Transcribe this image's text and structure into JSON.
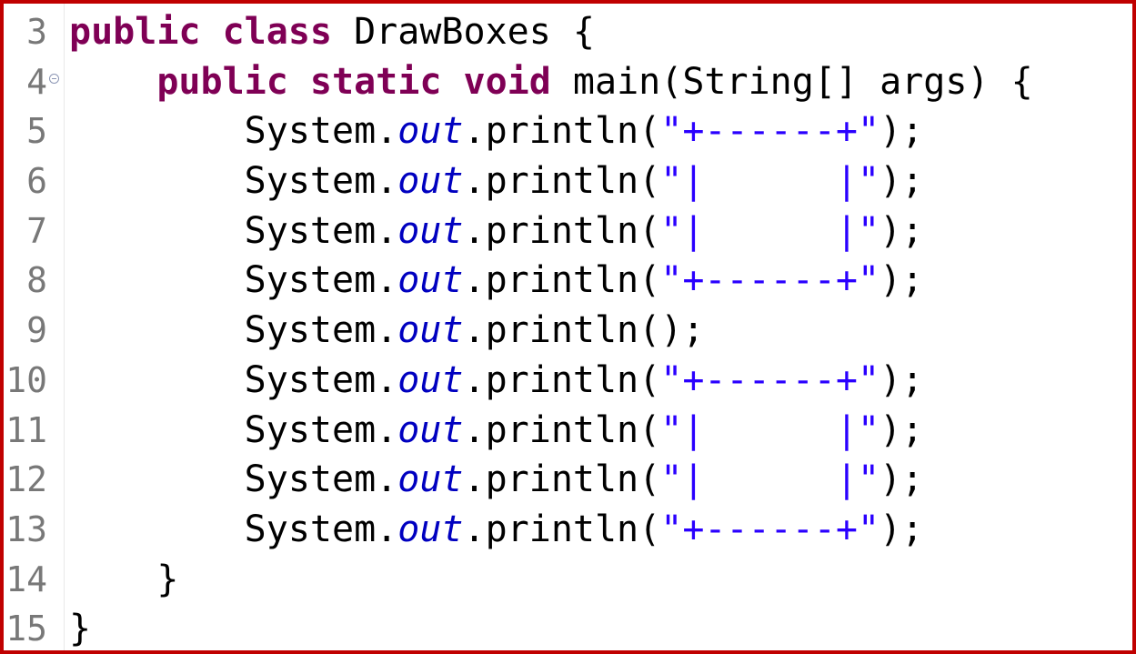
{
  "editor": {
    "lines": [
      {
        "no": "3",
        "indent": "",
        "tokens": [
          [
            "kw",
            "public"
          ],
          [
            "p",
            " "
          ],
          [
            "kw",
            "class"
          ],
          [
            "p",
            " DrawBoxes {"
          ]
        ]
      },
      {
        "no": "4",
        "indent": "    ",
        "fold": true,
        "tokens": [
          [
            "kw",
            "public"
          ],
          [
            "p",
            " "
          ],
          [
            "kw",
            "static"
          ],
          [
            "p",
            " "
          ],
          [
            "kw",
            "void"
          ],
          [
            "p",
            " main(String[] args) {"
          ]
        ]
      },
      {
        "no": "5",
        "indent": "        ",
        "tokens": [
          [
            "p",
            "System."
          ],
          [
            "field",
            "out"
          ],
          [
            "p",
            ".println("
          ],
          [
            "str",
            "\"+------+\""
          ],
          [
            "p",
            ");"
          ]
        ]
      },
      {
        "no": "6",
        "indent": "        ",
        "tokens": [
          [
            "p",
            "System."
          ],
          [
            "field",
            "out"
          ],
          [
            "p",
            ".println("
          ],
          [
            "str",
            "\"|      |\""
          ],
          [
            "p",
            ");"
          ]
        ]
      },
      {
        "no": "7",
        "indent": "        ",
        "tokens": [
          [
            "p",
            "System."
          ],
          [
            "field",
            "out"
          ],
          [
            "p",
            ".println("
          ],
          [
            "str",
            "\"|      |\""
          ],
          [
            "p",
            ");"
          ]
        ]
      },
      {
        "no": "8",
        "indent": "        ",
        "tokens": [
          [
            "p",
            "System."
          ],
          [
            "field",
            "out"
          ],
          [
            "p",
            ".println("
          ],
          [
            "str",
            "\"+------+\""
          ],
          [
            "p",
            ");"
          ]
        ]
      },
      {
        "no": "9",
        "indent": "        ",
        "tokens": [
          [
            "p",
            "System."
          ],
          [
            "field",
            "out"
          ],
          [
            "p",
            ".println();"
          ]
        ]
      },
      {
        "no": "10",
        "indent": "        ",
        "tokens": [
          [
            "p",
            "System."
          ],
          [
            "field",
            "out"
          ],
          [
            "p",
            ".println("
          ],
          [
            "str",
            "\"+------+\""
          ],
          [
            "p",
            ");"
          ]
        ]
      },
      {
        "no": "11",
        "indent": "        ",
        "tokens": [
          [
            "p",
            "System."
          ],
          [
            "field",
            "out"
          ],
          [
            "p",
            ".println("
          ],
          [
            "str",
            "\"|      |\""
          ],
          [
            "p",
            ");"
          ]
        ]
      },
      {
        "no": "12",
        "indent": "        ",
        "tokens": [
          [
            "p",
            "System."
          ],
          [
            "field",
            "out"
          ],
          [
            "p",
            ".println("
          ],
          [
            "str",
            "\"|      |\""
          ],
          [
            "p",
            ");"
          ]
        ]
      },
      {
        "no": "13",
        "indent": "        ",
        "tokens": [
          [
            "p",
            "System."
          ],
          [
            "field",
            "out"
          ],
          [
            "p",
            ".println("
          ],
          [
            "str",
            "\"+------+\""
          ],
          [
            "p",
            ");"
          ]
        ]
      },
      {
        "no": "14",
        "indent": "    ",
        "tokens": [
          [
            "p",
            "}"
          ]
        ]
      },
      {
        "no": "15",
        "indent": "",
        "tokens": [
          [
            "p",
            "}"
          ]
        ]
      }
    ]
  },
  "colors": {
    "keyword": "#7f0055",
    "field": "#0000c0",
    "string": "#2a00ff",
    "line_number": "#787878",
    "border": "#c00000"
  }
}
